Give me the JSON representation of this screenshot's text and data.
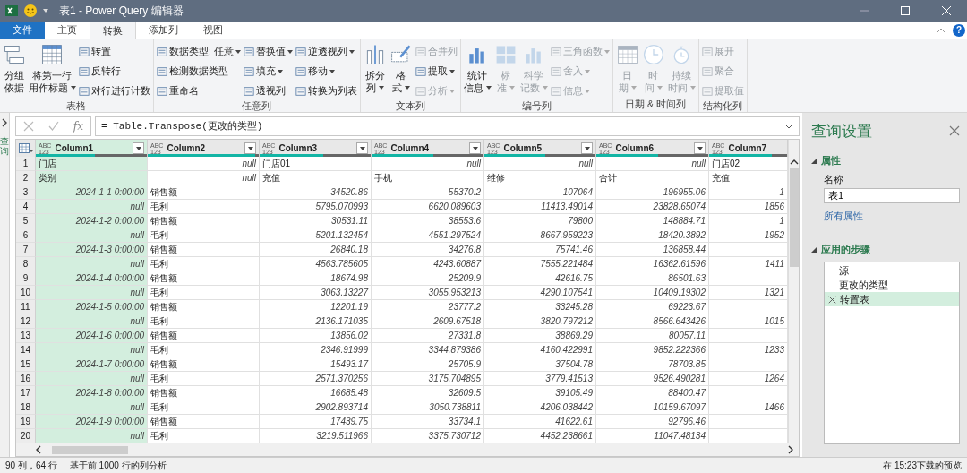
{
  "title_bar": {
    "title": "表1 - Power Query 编辑器"
  },
  "ribbon_tabs": [
    {
      "label": "文件",
      "kind": "file",
      "selected": false
    },
    {
      "label": "主页",
      "kind": "tab",
      "selected": false
    },
    {
      "label": "转换",
      "kind": "tab",
      "selected": true
    },
    {
      "label": "添加列",
      "kind": "tab",
      "selected": false
    },
    {
      "label": "视图",
      "kind": "tab",
      "selected": false
    }
  ],
  "help": "?",
  "ribbon_groups": [
    {
      "label": "表格",
      "items": [
        {
          "kind": "large",
          "lines": [
            "分组",
            "依据"
          ],
          "dropdown": false,
          "disabled": false
        },
        {
          "kind": "large",
          "lines": [
            "将第一行",
            "用作标题"
          ],
          "dropdown": true,
          "disabled": false
        },
        {
          "kind": "stack",
          "items": [
            {
              "label": "转置",
              "dropdown": false,
              "disabled": false
            },
            {
              "label": "反转行",
              "dropdown": false,
              "disabled": false
            },
            {
              "label": "对行进行计数",
              "dropdown": false,
              "disabled": false
            }
          ]
        }
      ]
    },
    {
      "label": "任意列",
      "items": [
        {
          "kind": "stack",
          "items": [
            {
              "label": "数据类型: 任意",
              "dropdown": true,
              "disabled": false
            },
            {
              "label": "检测数据类型",
              "dropdown": false,
              "disabled": false
            },
            {
              "label": "重命名",
              "dropdown": false,
              "disabled": false
            }
          ]
        },
        {
          "kind": "stack",
          "items": [
            {
              "label": "替换值",
              "dropdown": true,
              "disabled": false
            },
            {
              "label": "填充",
              "dropdown": true,
              "disabled": false
            },
            {
              "label": "透视列",
              "dropdown": false,
              "disabled": false
            }
          ]
        },
        {
          "kind": "stack",
          "items": [
            {
              "label": "逆透视列",
              "dropdown": true,
              "disabled": false
            },
            {
              "label": "移动",
              "dropdown": true,
              "disabled": false
            },
            {
              "label": "转换为列表",
              "dropdown": false,
              "disabled": false
            }
          ]
        }
      ]
    },
    {
      "label": "文本列",
      "items": [
        {
          "kind": "large",
          "lines": [
            "拆分",
            "列"
          ],
          "dropdown": true,
          "disabled": false
        },
        {
          "kind": "large",
          "lines": [
            "格",
            "式"
          ],
          "dropdown": true,
          "disabled": false
        },
        {
          "kind": "stack",
          "items": [
            {
              "label": "合并列",
              "dropdown": false,
              "disabled": true
            },
            {
              "label": "提取",
              "dropdown": true,
              "disabled": false
            },
            {
              "label": "分析",
              "dropdown": true,
              "disabled": true
            }
          ]
        }
      ]
    },
    {
      "label": "编号列",
      "items": [
        {
          "kind": "large",
          "lines": [
            "统计",
            "信息"
          ],
          "dropdown": true,
          "disabled": false
        },
        {
          "kind": "large",
          "lines": [
            "标",
            "准"
          ],
          "dropdown": true,
          "disabled": true
        },
        {
          "kind": "large",
          "lines": [
            "科学",
            "记数"
          ],
          "dropdown": true,
          "disabled": true
        },
        {
          "kind": "stack",
          "items": [
            {
              "label": "三角函数",
              "dropdown": true,
              "disabled": true
            },
            {
              "label": "舍入",
              "dropdown": true,
              "disabled": true
            },
            {
              "label": "信息",
              "dropdown": true,
              "disabled": true
            }
          ]
        }
      ]
    },
    {
      "label": "日期 & 时间列",
      "items": [
        {
          "kind": "large",
          "lines": [
            "日",
            "期"
          ],
          "dropdown": true,
          "disabled": true
        },
        {
          "kind": "large",
          "lines": [
            "时",
            "间"
          ],
          "dropdown": true,
          "disabled": true
        },
        {
          "kind": "large",
          "lines": [
            "持续",
            "时间"
          ],
          "dropdown": true,
          "disabled": true
        }
      ]
    },
    {
      "label": "结构化列",
      "items": [
        {
          "kind": "stack",
          "items": [
            {
              "label": "展开",
              "dropdown": false,
              "disabled": true
            },
            {
              "label": "聚合",
              "dropdown": false,
              "disabled": true
            },
            {
              "label": "提取值",
              "dropdown": false,
              "disabled": true
            }
          ]
        }
      ]
    }
  ],
  "queries_pane": {
    "label": "查询"
  },
  "formula_bar": {
    "fx": "fx",
    "formula": "= Table.Transpose(更改的类型)"
  },
  "table": {
    "columns": [
      {
        "type": [
          "ABC",
          "123"
        ],
        "name": "Column1",
        "selected": true,
        "dropdown": true,
        "level": 0.53
      },
      {
        "type": [
          "ABC",
          "123"
        ],
        "name": "Column2",
        "selected": false,
        "dropdown": true,
        "level": 0.97
      },
      {
        "type": [
          "ABC",
          "123"
        ],
        "name": "Column3",
        "selected": false,
        "dropdown": true,
        "level": 0.57
      },
      {
        "type": [
          "ABC",
          "123"
        ],
        "name": "Column4",
        "selected": false,
        "dropdown": true,
        "level": 0.55
      },
      {
        "type": [
          "ABC",
          "123"
        ],
        "name": "Column5",
        "selected": false,
        "dropdown": true,
        "level": 0.55
      },
      {
        "type": [
          "ABC",
          "123"
        ],
        "name": "Column6",
        "selected": false,
        "dropdown": true,
        "level": 0.55
      },
      {
        "type": [
          "ABC",
          "123"
        ],
        "name": "Column7",
        "selected": false,
        "dropdown": false,
        "level": 0.8
      }
    ],
    "rows": [
      {
        "number": "1",
        "cells": [
          {
            "kind": "text",
            "text": "门店"
          },
          {
            "kind": "value",
            "text": "null"
          },
          {
            "kind": "text",
            "text": "门店01"
          },
          {
            "kind": "value",
            "text": "null"
          },
          {
            "kind": "value",
            "text": "null"
          },
          {
            "kind": "value",
            "text": "null"
          },
          {
            "kind": "text",
            "text": "门店02"
          }
        ]
      },
      {
        "number": "2",
        "cells": [
          {
            "kind": "text",
            "text": "类别"
          },
          {
            "kind": "value",
            "text": "null"
          },
          {
            "kind": "text",
            "text": "充值"
          },
          {
            "kind": "text",
            "text": "手机"
          },
          {
            "kind": "text",
            "text": "维修"
          },
          {
            "kind": "text",
            "text": "合计"
          },
          {
            "kind": "text",
            "text": "充值"
          }
        ]
      },
      {
        "number": "3",
        "cells": [
          {
            "kind": "value",
            "text": "2024-1-1 0:00:00"
          },
          {
            "kind": "text",
            "text": "销售额"
          },
          {
            "kind": "value",
            "text": "34520.86"
          },
          {
            "kind": "value",
            "text": "55370.2"
          },
          {
            "kind": "value",
            "text": "107064"
          },
          {
            "kind": "value",
            "text": "196955.06"
          },
          {
            "kind": "value",
            "text": "1"
          }
        ]
      },
      {
        "number": "4",
        "cells": [
          {
            "kind": "value",
            "text": "null"
          },
          {
            "kind": "text",
            "text": "毛利"
          },
          {
            "kind": "value",
            "text": "5795.070993"
          },
          {
            "kind": "value",
            "text": "6620.089603"
          },
          {
            "kind": "value",
            "text": "11413.49014"
          },
          {
            "kind": "value",
            "text": "23828.65074"
          },
          {
            "kind": "value",
            "text": "1856"
          }
        ]
      },
      {
        "number": "5",
        "cells": [
          {
            "kind": "value",
            "text": "2024-1-2 0:00:00"
          },
          {
            "kind": "text",
            "text": "销售额"
          },
          {
            "kind": "value",
            "text": "30531.11"
          },
          {
            "kind": "value",
            "text": "38553.6"
          },
          {
            "kind": "value",
            "text": "79800"
          },
          {
            "kind": "value",
            "text": "148884.71"
          },
          {
            "kind": "value",
            "text": "1"
          }
        ]
      },
      {
        "number": "6",
        "cells": [
          {
            "kind": "value",
            "text": "null"
          },
          {
            "kind": "text",
            "text": "毛利"
          },
          {
            "kind": "value",
            "text": "5201.132454"
          },
          {
            "kind": "value",
            "text": "4551.297524"
          },
          {
            "kind": "value",
            "text": "8667.959223"
          },
          {
            "kind": "value",
            "text": "18420.3892"
          },
          {
            "kind": "value",
            "text": "1952"
          }
        ]
      },
      {
        "number": "7",
        "cells": [
          {
            "kind": "value",
            "text": "2024-1-3 0:00:00"
          },
          {
            "kind": "text",
            "text": "销售额"
          },
          {
            "kind": "value",
            "text": "26840.18"
          },
          {
            "kind": "value",
            "text": "34276.8"
          },
          {
            "kind": "value",
            "text": "75741.46"
          },
          {
            "kind": "value",
            "text": "136858.44"
          },
          {
            "kind": "empty"
          }
        ]
      },
      {
        "number": "8",
        "cells": [
          {
            "kind": "value",
            "text": "null"
          },
          {
            "kind": "text",
            "text": "毛利"
          },
          {
            "kind": "value",
            "text": "4563.785605"
          },
          {
            "kind": "value",
            "text": "4243.60887"
          },
          {
            "kind": "value",
            "text": "7555.221484"
          },
          {
            "kind": "value",
            "text": "16362.61596"
          },
          {
            "kind": "value",
            "text": "1411"
          }
        ]
      },
      {
        "number": "9",
        "cells": [
          {
            "kind": "value",
            "text": "2024-1-4 0:00:00"
          },
          {
            "kind": "text",
            "text": "销售额"
          },
          {
            "kind": "value",
            "text": "18674.98"
          },
          {
            "kind": "value",
            "text": "25209.9"
          },
          {
            "kind": "value",
            "text": "42616.75"
          },
          {
            "kind": "value",
            "text": "86501.63"
          },
          {
            "kind": "empty"
          }
        ]
      },
      {
        "number": "10",
        "cells": [
          {
            "kind": "value",
            "text": "null"
          },
          {
            "kind": "text",
            "text": "毛利"
          },
          {
            "kind": "value",
            "text": "3063.13227"
          },
          {
            "kind": "value",
            "text": "3055.953213"
          },
          {
            "kind": "value",
            "text": "4290.107541"
          },
          {
            "kind": "value",
            "text": "10409.19302"
          },
          {
            "kind": "value",
            "text": "1321"
          }
        ]
      },
      {
        "number": "11",
        "cells": [
          {
            "kind": "value",
            "text": "2024-1-5 0:00:00"
          },
          {
            "kind": "text",
            "text": "销售额"
          },
          {
            "kind": "value",
            "text": "12201.19"
          },
          {
            "kind": "value",
            "text": "23777.2"
          },
          {
            "kind": "value",
            "text": "33245.28"
          },
          {
            "kind": "value",
            "text": "69223.67"
          },
          {
            "kind": "empty"
          }
        ]
      },
      {
        "number": "12",
        "cells": [
          {
            "kind": "value",
            "text": "null"
          },
          {
            "kind": "text",
            "text": "毛利"
          },
          {
            "kind": "value",
            "text": "2136.171035"
          },
          {
            "kind": "value",
            "text": "2609.67518"
          },
          {
            "kind": "value",
            "text": "3820.797212"
          },
          {
            "kind": "value",
            "text": "8566.643426"
          },
          {
            "kind": "value",
            "text": "1015"
          }
        ]
      },
      {
        "number": "13",
        "cells": [
          {
            "kind": "value",
            "text": "2024-1-6 0:00:00"
          },
          {
            "kind": "text",
            "text": "销售额"
          },
          {
            "kind": "value",
            "text": "13856.02"
          },
          {
            "kind": "value",
            "text": "27331.8"
          },
          {
            "kind": "value",
            "text": "38869.29"
          },
          {
            "kind": "value",
            "text": "80057.11"
          },
          {
            "kind": "empty"
          }
        ]
      },
      {
        "number": "14",
        "cells": [
          {
            "kind": "value",
            "text": "null"
          },
          {
            "kind": "text",
            "text": "毛利"
          },
          {
            "kind": "value",
            "text": "2346.91999"
          },
          {
            "kind": "value",
            "text": "3344.879386"
          },
          {
            "kind": "value",
            "text": "4160.422991"
          },
          {
            "kind": "value",
            "text": "9852.222366"
          },
          {
            "kind": "value",
            "text": "1233"
          }
        ]
      },
      {
        "number": "15",
        "cells": [
          {
            "kind": "value",
            "text": "2024-1-7 0:00:00"
          },
          {
            "kind": "text",
            "text": "销售额"
          },
          {
            "kind": "value",
            "text": "15493.17"
          },
          {
            "kind": "value",
            "text": "25705.9"
          },
          {
            "kind": "value",
            "text": "37504.78"
          },
          {
            "kind": "value",
            "text": "78703.85"
          },
          {
            "kind": "empty"
          }
        ]
      },
      {
        "number": "16",
        "cells": [
          {
            "kind": "value",
            "text": "null"
          },
          {
            "kind": "text",
            "text": "毛利"
          },
          {
            "kind": "value",
            "text": "2571.370256"
          },
          {
            "kind": "value",
            "text": "3175.704895"
          },
          {
            "kind": "value",
            "text": "3779.41513"
          },
          {
            "kind": "value",
            "text": "9526.490281"
          },
          {
            "kind": "value",
            "text": "1264"
          }
        ]
      },
      {
        "number": "17",
        "cells": [
          {
            "kind": "value",
            "text": "2024-1-8 0:00:00"
          },
          {
            "kind": "text",
            "text": "销售额"
          },
          {
            "kind": "value",
            "text": "16685.48"
          },
          {
            "kind": "value",
            "text": "32609.5"
          },
          {
            "kind": "value",
            "text": "39105.49"
          },
          {
            "kind": "value",
            "text": "88400.47"
          },
          {
            "kind": "empty"
          }
        ]
      },
      {
        "number": "18",
        "cells": [
          {
            "kind": "value",
            "text": "null"
          },
          {
            "kind": "text",
            "text": "毛利"
          },
          {
            "kind": "value",
            "text": "2902.893714"
          },
          {
            "kind": "value",
            "text": "3050.738811"
          },
          {
            "kind": "value",
            "text": "4206.038442"
          },
          {
            "kind": "value",
            "text": "10159.67097"
          },
          {
            "kind": "value",
            "text": "1466"
          }
        ]
      },
      {
        "number": "19",
        "cells": [
          {
            "kind": "value",
            "text": "2024-1-9 0:00:00"
          },
          {
            "kind": "text",
            "text": "销售额"
          },
          {
            "kind": "value",
            "text": "17439.75"
          },
          {
            "kind": "value",
            "text": "33734.1"
          },
          {
            "kind": "value",
            "text": "41622.61"
          },
          {
            "kind": "value",
            "text": "92796.46"
          },
          {
            "kind": "empty"
          }
        ]
      },
      {
        "number": "20",
        "cells": [
          {
            "kind": "value",
            "text": "null"
          },
          {
            "kind": "text",
            "text": "毛利"
          },
          {
            "kind": "value",
            "text": "3219.511966"
          },
          {
            "kind": "value",
            "text": "3375.730712"
          },
          {
            "kind": "value",
            "text": "4452.238661"
          },
          {
            "kind": "value",
            "text": "11047.48134"
          },
          {
            "kind": "empty"
          }
        ]
      }
    ]
  },
  "query_settings": {
    "title": "查询设置",
    "properties_heading": "属性",
    "name_label": "名称",
    "name_value": "表1",
    "all_properties_link": "所有属性",
    "steps_heading": "应用的步骤",
    "steps": [
      {
        "label": "源",
        "selected": false
      },
      {
        "label": "更改的类型",
        "selected": false
      },
      {
        "label": "转置表",
        "selected": true
      }
    ]
  },
  "status_bar": {
    "counts": "90 列，64 行",
    "profiling": "基于前 1000 行的列分析",
    "preview": "在 15:23下载的预览"
  }
}
